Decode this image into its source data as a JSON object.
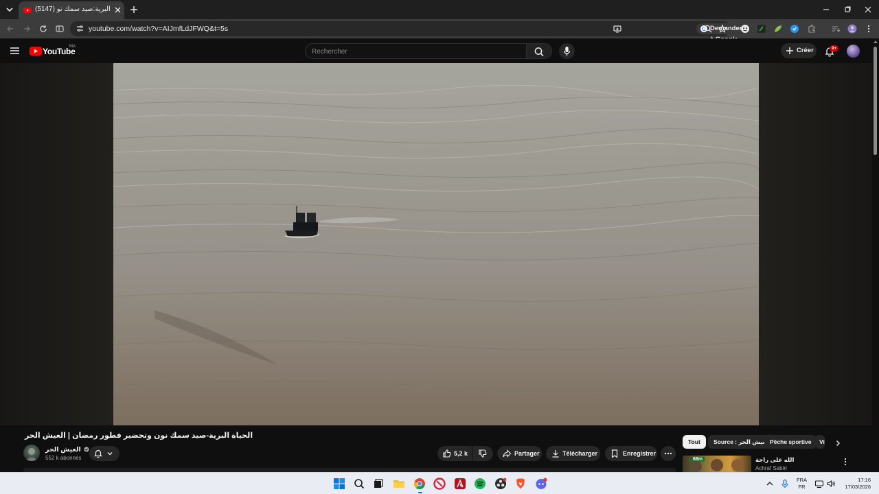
{
  "browser": {
    "tab_title": "(5147) الحياة البرية:صيد سمك نو",
    "url": "youtube.com/watch?v=AIJmfLdJFWQ&t=5s",
    "ask_google": "Demander à Google"
  },
  "youtube": {
    "logo_text": "YouTube",
    "region": "MA",
    "search_placeholder": "Rechercher",
    "create_label": "Créer",
    "notifications_badge": "9+"
  },
  "video": {
    "title": "الحياة البرية-صيد سمك نون وتحضير فطور رمضان | العيش الحر",
    "channel_name": "العيش الحر",
    "subscribers": "552 k abonnés",
    "likes": "5,2 k",
    "share_label": "Partager",
    "download_label": "Télécharger",
    "save_label": "Enregistrer"
  },
  "chips": {
    "all": "Tout",
    "source": "Source : العيش الحر",
    "peche": "Pêche sportive",
    "partial": "Vi"
  },
  "recommendation": {
    "thumb_badge": "68m",
    "title": "الله على راحة",
    "channel": "Achraf Sabiri"
  },
  "taskbar": {
    "lang_line1": "FRA",
    "lang_line2": "FR",
    "time": "17:16",
    "date": "17/03/2026"
  },
  "colors": {
    "youtube_red": "#ff0000",
    "background": "#0f0f0f",
    "chip_active": "#f1f1f1"
  }
}
